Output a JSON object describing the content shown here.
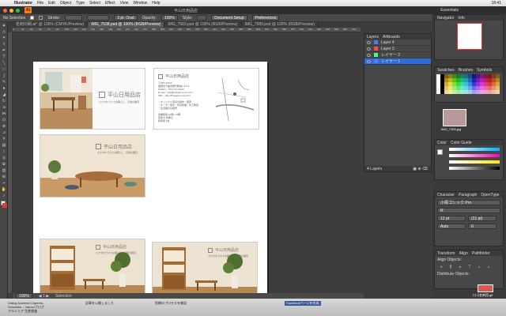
{
  "menubar": {
    "apple": "",
    "app_name": "Illustrator",
    "items": [
      "File",
      "Edit",
      "Object",
      "Type",
      "Select",
      "Effect",
      "View",
      "Window",
      "Help"
    ],
    "clock": "18:41"
  },
  "titlebar": {
    "document_title": "平山日用品店",
    "workspace": "Essentials"
  },
  "controlbar": {
    "selection": "No Selection",
    "stroke_label": "Stroke:",
    "stroke_value": "",
    "brush_value": "3 pt. Oval",
    "opacity_label": "Opacity:",
    "opacity_value": "100%",
    "style_label": "Style:",
    "document_setup": "Document Setup",
    "preferences": "Preferences"
  },
  "tabs": [
    {
      "label": "名刺印刷.ai* @ 100% (CMYK/Preview)",
      "active": false
    },
    {
      "label": "IMG_7538.psd @ 100% (RGB/Preview)",
      "active": true
    },
    {
      "label": "IMG_7583.psd @ 100% (RGB/Preview)",
      "active": false
    },
    {
      "label": "IMG_7589.psd @ 100% (RGB/Preview)",
      "active": false
    }
  ],
  "ruler_ticks": [
    "0",
    "18",
    "36",
    "54",
    "72",
    "90",
    "108",
    "126",
    "144",
    "162",
    "180",
    "198",
    "216",
    "234",
    "252",
    "270",
    "288",
    "306",
    "324",
    "342",
    "360",
    "378",
    "396",
    "414",
    "432",
    "450",
    "468",
    "486",
    "504",
    "522",
    "540",
    "558",
    "576",
    "594",
    "612",
    "630",
    "648",
    "666",
    "684",
    "702",
    "720"
  ],
  "card": {
    "shop_name": "平山日用品店",
    "tagline": "ささやかで小さな暮らし、日用の雑貨",
    "address_lines": [
      "〒3XX-XXXX",
      "長野県千曲市屋代駅前1-XX-1",
      "Tel/Fax：XXX-XX-XXXX",
      "E-mail：info@hirayama-xxx.com",
      "URL：http://hirayama-xxx.com"
    ],
    "features": [
      "・オリジナル家具の製作・販売",
      "・オーダー家具・家具修理・木工教室",
      "・生活雑貨の販売"
    ],
    "hours": [
      {
        "k": "営業時間",
        "v": "12時〜19時"
      },
      {
        "k": "定休日",
        "v": "水曜日"
      },
      {
        "k": "駐車場",
        "v": "3台"
      }
    ]
  },
  "layers_panel": {
    "tabs": [
      "Layers",
      "Artboards"
    ],
    "layers": [
      {
        "name": "Layer 4",
        "color": "#4a7cff"
      },
      {
        "name": "Layer 3",
        "color": "#ff4a4a"
      },
      {
        "name": "レイヤー 2",
        "color": "#4aff7c"
      },
      {
        "name": "レイヤー 1",
        "color": "#4a7cff"
      }
    ],
    "footer": "4 Layers"
  },
  "right_panels": {
    "navigator_tabs": [
      "Navigator",
      "Info"
    ],
    "swatch_tabs": [
      "Swatches",
      "Brushes",
      "Symbols"
    ],
    "color_tabs": [
      "Color",
      "Color Guide"
    ],
    "character_tabs": [
      "Character",
      "Paragraph",
      "OpenType"
    ],
    "font_name": "小塚ゴシック Pro",
    "font_style": "R",
    "font_size": "12 pt",
    "leading": "(21 pt)",
    "kerning": "Auto",
    "tracking": "0",
    "transform_tabs": [
      "Transform",
      "Align",
      "Pathfinder"
    ],
    "align_objects": "Align Objects:",
    "distribute_objects": "Distribute Objects:"
  },
  "desktop": {
    "file1": "IMG_7405.jpg",
    "file2": "ロゴ名刺用.gif"
  },
  "status": {
    "zoom": "100%",
    "tool": "Selection"
  },
  "taskbar_items": [
    "Dialog Aluminia Caperita...",
    "Schwinke – Yahoo!ブログ",
    "アルミニア 生産検査",
    "記事を公開しました",
    "投稿のプロセスを確認",
    "Facebookページを作成"
  ],
  "colors": {
    "accent": "#ff7c00",
    "selection_blue": "#2e6ed8"
  }
}
